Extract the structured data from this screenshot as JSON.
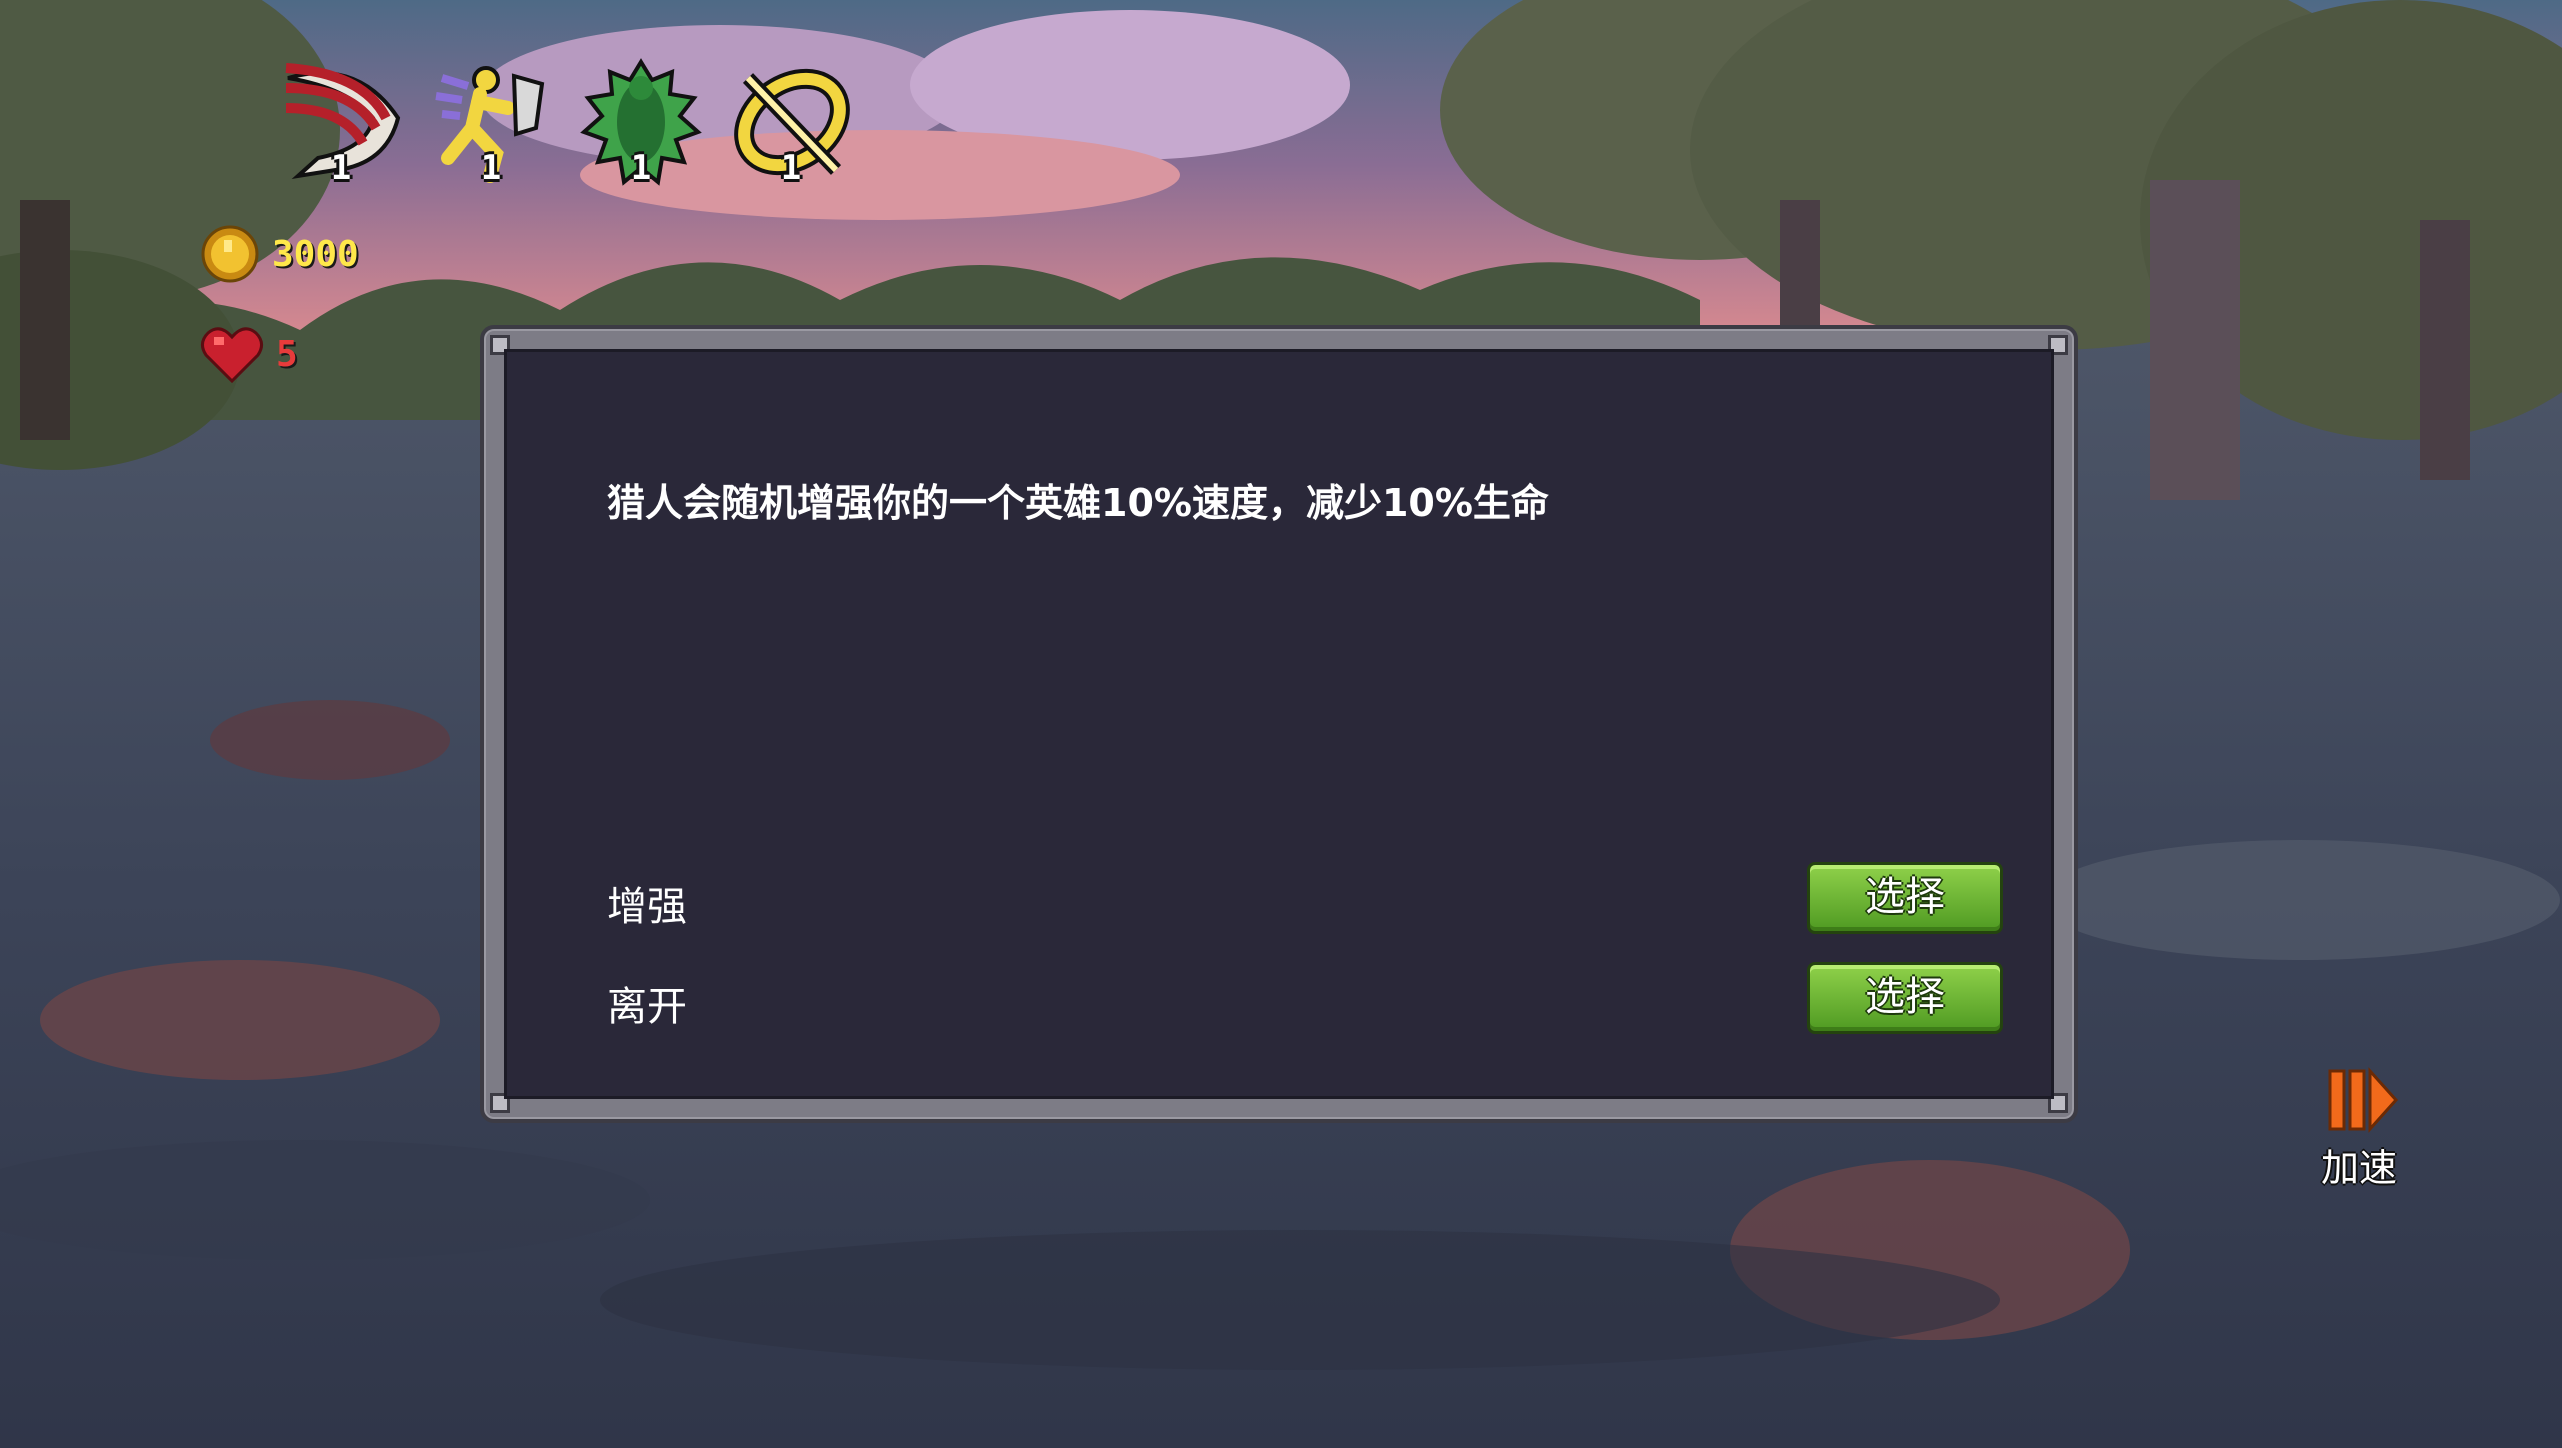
{
  "hud": {
    "buffs": [
      {
        "icon": "claw-slash-icon",
        "count": "1"
      },
      {
        "icon": "running-shield-icon",
        "count": "1"
      },
      {
        "icon": "spiky-green-figure-icon",
        "count": "1"
      },
      {
        "icon": "golden-ring-sword-icon",
        "count": "1"
      }
    ],
    "gold": {
      "icon": "gold-coin-icon",
      "value": "3000",
      "color": "#ffe84a"
    },
    "lives": {
      "icon": "heart-icon",
      "value": "5",
      "color": "#e83b3b"
    }
  },
  "dialog": {
    "text": "猎人会随机增强你的一个英雄10%速度，减少10%生命",
    "options": [
      {
        "label": "增强",
        "button": "选择"
      },
      {
        "label": "离开",
        "button": "选择"
      }
    ]
  },
  "speed_button": {
    "icon": "fast-forward-icon",
    "label": "加速",
    "color": "#f26a1b"
  }
}
